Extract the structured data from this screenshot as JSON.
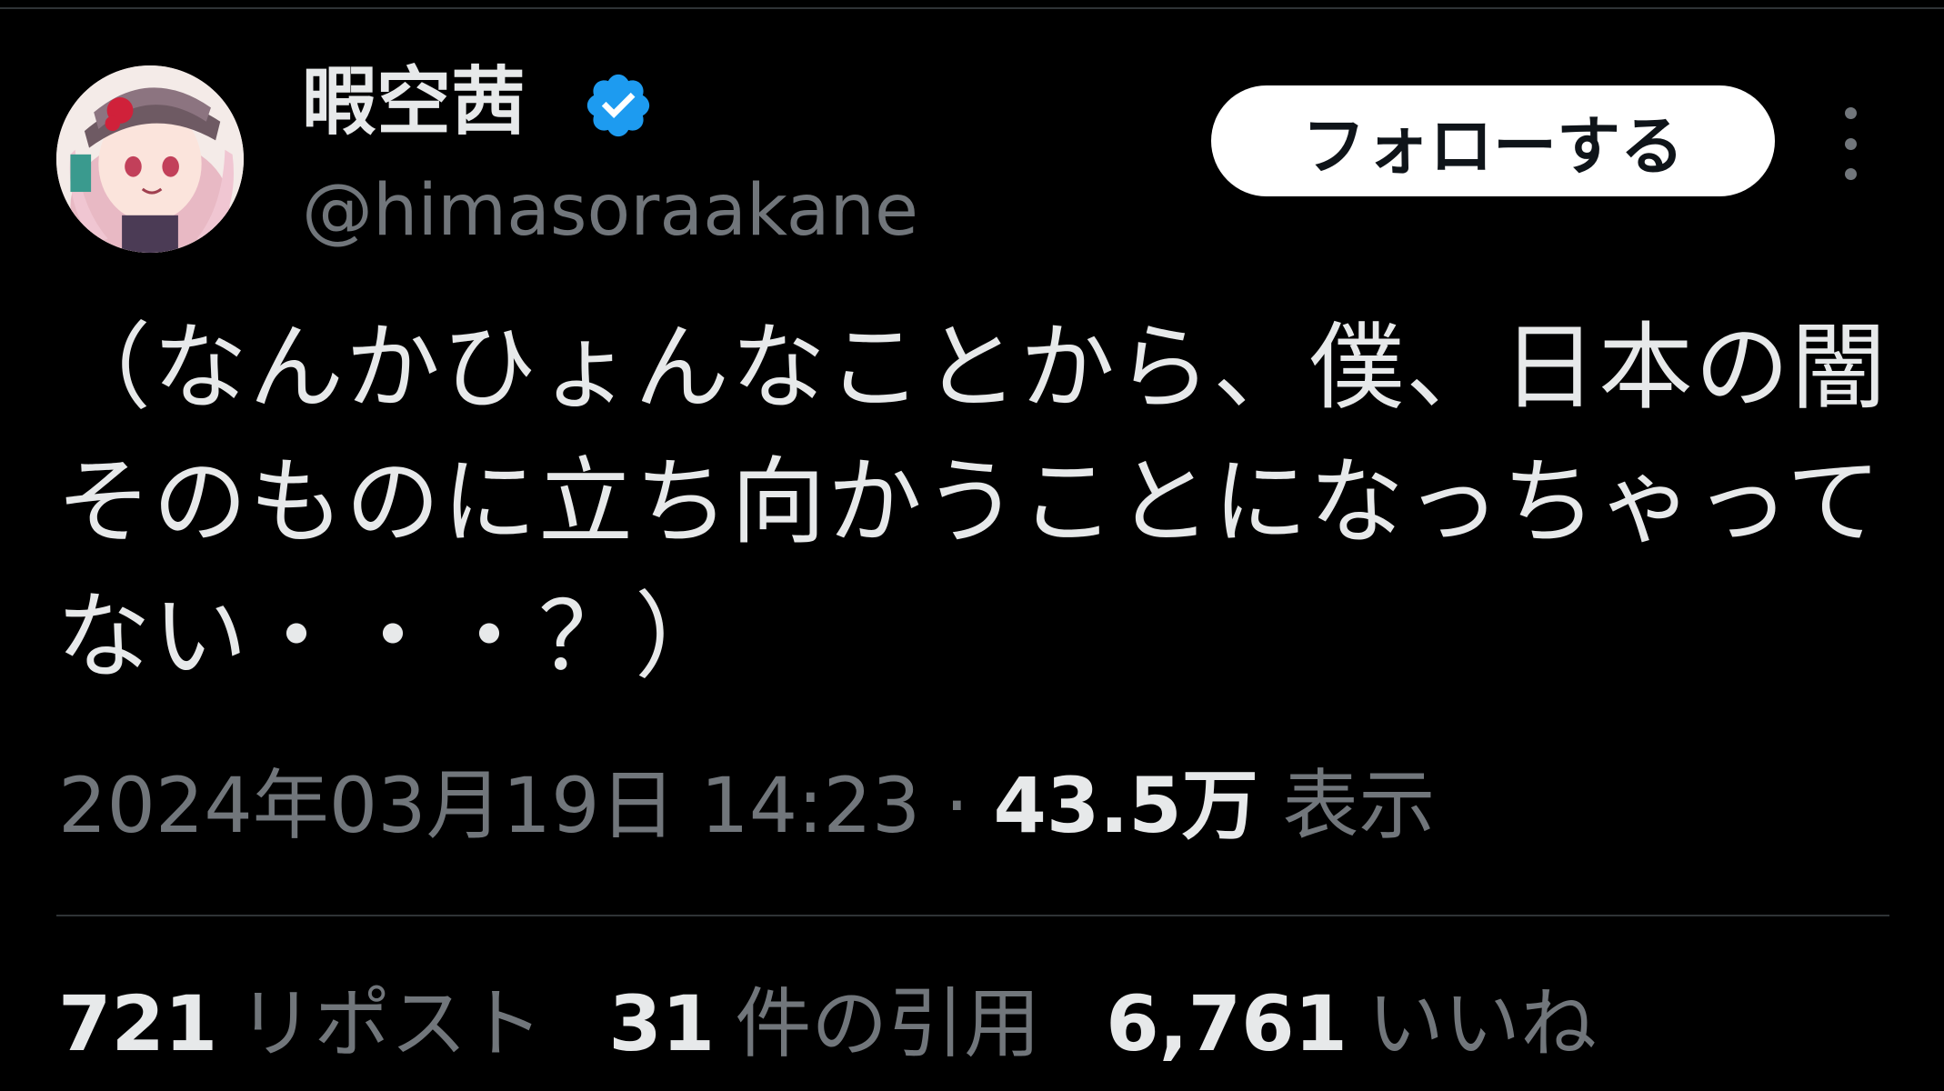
{
  "user": {
    "display_name": "暇空茜",
    "handle": "@himasoraakane",
    "verified_icon": "verified-badge-icon",
    "verified_color": "#1d9bf0"
  },
  "actions": {
    "follow_label": "フォローする",
    "more_icon": "more-vertical-icon"
  },
  "tweet": {
    "text": "（なんかひょんなことから、僕、日本の闇そのものに立ち向かうことになっちゃってない・・・？）"
  },
  "meta": {
    "timestamp": "2024年03月19日 14:23",
    "separator": " · ",
    "views_count": "43.5万",
    "views_label": "表示"
  },
  "stats": {
    "reposts": {
      "count": "721",
      "label": "リポスト"
    },
    "quotes": {
      "count": "31",
      "label": "件の引用"
    },
    "likes": {
      "count": "6,761",
      "label": "いいね"
    }
  },
  "colors": {
    "background": "#000000",
    "primary_text": "#e7e9ea",
    "secondary_text": "#71767b",
    "divider": "#2f3336",
    "follow_button_bg": "#ffffff"
  }
}
